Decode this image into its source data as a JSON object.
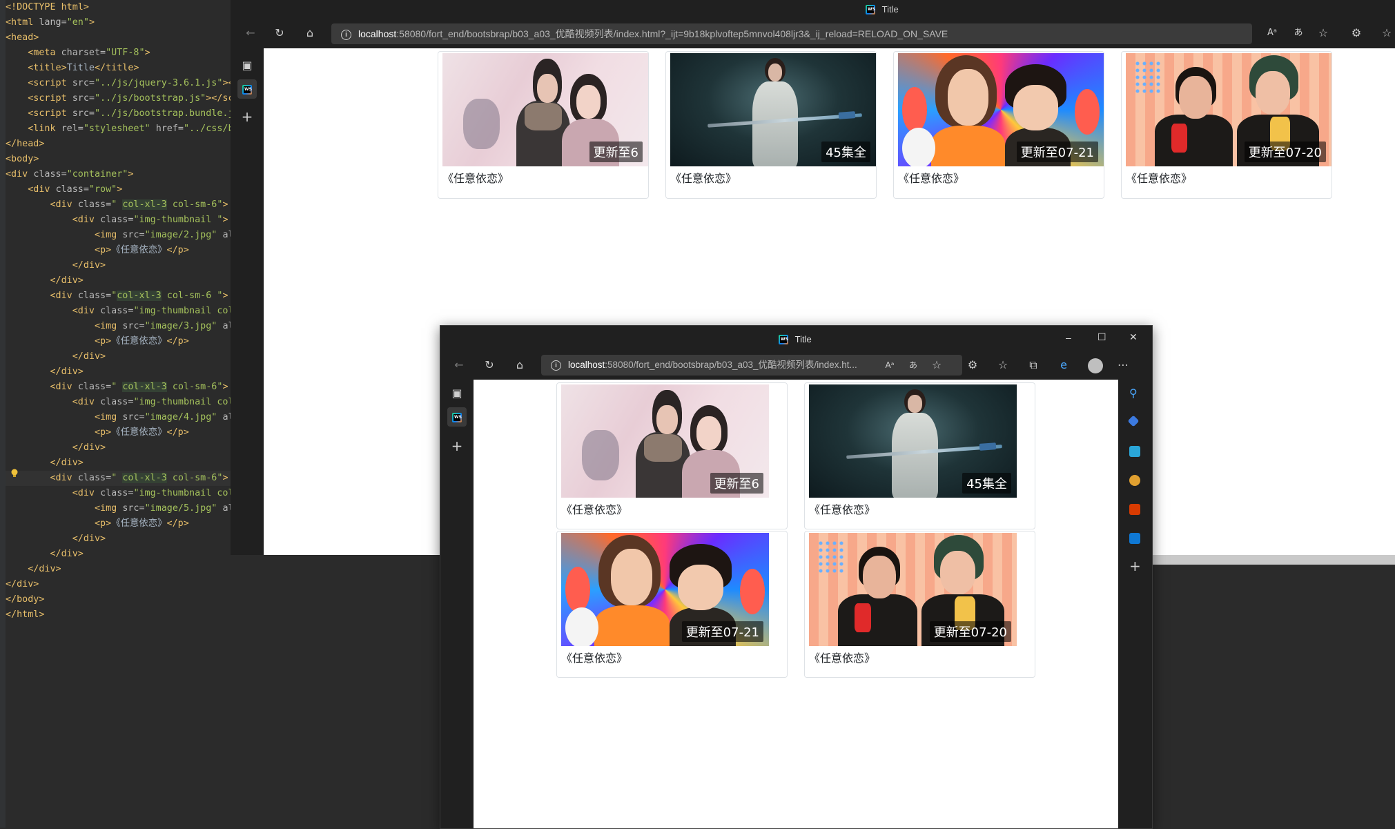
{
  "editor": {
    "lines": [
      [
        [
          "tag",
          "<!DOCTYPE html>"
        ]
      ],
      [
        [
          "tag",
          "<html "
        ],
        [
          "attr",
          "lang="
        ],
        [
          "str",
          "\"en\""
        ],
        [
          "tag",
          ">"
        ]
      ],
      [
        [
          "tag",
          "<head>"
        ]
      ],
      [
        [
          "txt",
          "    "
        ],
        [
          "tag",
          "<meta "
        ],
        [
          "attr",
          "charset="
        ],
        [
          "str",
          "\"UTF-8\""
        ],
        [
          "tag",
          ">"
        ]
      ],
      [
        [
          "txt",
          "    "
        ],
        [
          "tag",
          "<title>"
        ],
        [
          "txt",
          "Title"
        ],
        [
          "tag",
          "</title>"
        ]
      ],
      [
        [
          "txt",
          "    "
        ],
        [
          "tag",
          "<script "
        ],
        [
          "attr",
          "src="
        ],
        [
          "str",
          "\"../js/jquery-3.6.1.js\""
        ],
        [
          "tag",
          "><"
        ]
      ],
      [
        [
          "txt",
          "    "
        ],
        [
          "tag",
          "<script "
        ],
        [
          "attr",
          "src="
        ],
        [
          "str",
          "\"../js/bootstrap.js\""
        ],
        [
          "tag",
          "></sc"
        ]
      ],
      [
        [
          "txt",
          "    "
        ],
        [
          "tag",
          "<script "
        ],
        [
          "attr",
          "src="
        ],
        [
          "str",
          "\"../js/bootstrap.bundle.j"
        ]
      ],
      [
        [
          "txt",
          "    "
        ],
        [
          "tag",
          "<link "
        ],
        [
          "attr",
          "rel="
        ],
        [
          "str",
          "\"stylesheet\" "
        ],
        [
          "attr",
          "href="
        ],
        [
          "str",
          "\"../css/b"
        ]
      ],
      [
        [
          "tag",
          "</head>"
        ]
      ],
      [
        [
          "tag",
          "<body>"
        ]
      ],
      [
        [
          "tag",
          "<div "
        ],
        [
          "attr",
          "class="
        ],
        [
          "str",
          "\"container\""
        ],
        [
          "tag",
          ">"
        ]
      ],
      [
        [
          "txt",
          "    "
        ],
        [
          "tag",
          "<div "
        ],
        [
          "attr",
          "class="
        ],
        [
          "str",
          "\"row\""
        ],
        [
          "tag",
          ">"
        ]
      ],
      [
        [
          "txt",
          "        "
        ],
        [
          "tag",
          "<div "
        ],
        [
          "attr",
          "class="
        ],
        [
          "str",
          "\" "
        ],
        [
          "cls",
          "col-xl-3"
        ],
        [
          "str",
          " col-sm-6\""
        ],
        [
          "tag",
          ">"
        ]
      ],
      [
        [
          "txt",
          "            "
        ],
        [
          "tag",
          "<div "
        ],
        [
          "attr",
          "class="
        ],
        [
          "str",
          "\"img-thumbnail \""
        ],
        [
          "tag",
          ">"
        ]
      ],
      [
        [
          "txt",
          "                "
        ],
        [
          "tag",
          "<img "
        ],
        [
          "attr",
          "src="
        ],
        [
          "str",
          "\"image/2.jpg\" "
        ],
        [
          "attr",
          "al"
        ]
      ],
      [
        [
          "txt",
          "                "
        ],
        [
          "tag",
          "<p>"
        ],
        [
          "txt",
          "《任意依恋》"
        ],
        [
          "tag",
          "</p>"
        ]
      ],
      [
        [
          "txt",
          "            "
        ],
        [
          "tag",
          "</div>"
        ]
      ],
      [
        [
          "txt",
          "        "
        ],
        [
          "tag",
          "</div>"
        ]
      ],
      [
        [
          "txt",
          "        "
        ],
        [
          "tag",
          "<div "
        ],
        [
          "attr",
          "class="
        ],
        [
          "str",
          "\""
        ],
        [
          "cls",
          "col-xl-3"
        ],
        [
          "str",
          " col-sm-6 \""
        ],
        [
          "tag",
          ">"
        ]
      ],
      [
        [
          "txt",
          "            "
        ],
        [
          "tag",
          "<div "
        ],
        [
          "attr",
          "class="
        ],
        [
          "str",
          "\"img-thumbnail col"
        ]
      ],
      [
        [
          "txt",
          "                "
        ],
        [
          "tag",
          "<img "
        ],
        [
          "attr",
          "src="
        ],
        [
          "str",
          "\"image/3.jpg\" "
        ],
        [
          "attr",
          "al"
        ]
      ],
      [
        [
          "txt",
          "                "
        ],
        [
          "tag",
          "<p>"
        ],
        [
          "txt",
          "《任意依恋》"
        ],
        [
          "tag",
          "</p>"
        ]
      ],
      [
        [
          "txt",
          "            "
        ],
        [
          "tag",
          "</div>"
        ]
      ],
      [
        [
          "txt",
          "        "
        ],
        [
          "tag",
          "</div>"
        ]
      ],
      [
        [
          "txt",
          "        "
        ],
        [
          "tag",
          "<div "
        ],
        [
          "attr",
          "class="
        ],
        [
          "str",
          "\" "
        ],
        [
          "cls",
          "col-xl-3"
        ],
        [
          "str",
          " col-sm-6\""
        ],
        [
          "tag",
          ">"
        ]
      ],
      [
        [
          "txt",
          "            "
        ],
        [
          "tag",
          "<div "
        ],
        [
          "attr",
          "class="
        ],
        [
          "str",
          "\"img-thumbnail col"
        ]
      ],
      [
        [
          "txt",
          "                "
        ],
        [
          "tag",
          "<img "
        ],
        [
          "attr",
          "src="
        ],
        [
          "str",
          "\"image/4.jpg\" "
        ],
        [
          "attr",
          "al"
        ]
      ],
      [
        [
          "txt",
          "                "
        ],
        [
          "tag",
          "<p>"
        ],
        [
          "txt",
          "《任意依恋》"
        ],
        [
          "tag",
          "</p>"
        ]
      ],
      [
        [
          "txt",
          "            "
        ],
        [
          "tag",
          "</div>"
        ]
      ],
      [
        [
          "txt",
          "        "
        ],
        [
          "tag",
          "</div>"
        ]
      ],
      [
        [
          "txt",
          "        "
        ],
        [
          "tag",
          "<div "
        ],
        [
          "attr",
          "class="
        ],
        [
          "str",
          "\" "
        ],
        [
          "cls",
          "col-xl-3"
        ],
        [
          "str",
          " col-sm-6\""
        ],
        [
          "tag",
          ">"
        ]
      ],
      [
        [
          "txt",
          "            "
        ],
        [
          "tag",
          "<div "
        ],
        [
          "attr",
          "class="
        ],
        [
          "str",
          "\"img-thumbnail col"
        ]
      ],
      [
        [
          "txt",
          "                "
        ],
        [
          "tag",
          "<img "
        ],
        [
          "attr",
          "src="
        ],
        [
          "str",
          "\"image/5.jpg\" "
        ],
        [
          "attr",
          "al"
        ]
      ],
      [
        [
          "txt",
          "                "
        ],
        [
          "tag",
          "<p>"
        ],
        [
          "txt",
          "《任意依恋》"
        ],
        [
          "tag",
          "</p>"
        ]
      ],
      [
        [
          "txt",
          "            "
        ],
        [
          "tag",
          "</div>"
        ]
      ],
      [
        [
          "txt",
          "        "
        ],
        [
          "tag",
          "</div>"
        ]
      ],
      [
        [
          "txt",
          "    "
        ],
        [
          "tag",
          "</div>"
        ]
      ],
      [
        [
          "tag",
          "</div>"
        ]
      ],
      [
        [
          "tag",
          "</body>"
        ]
      ],
      [
        [
          "tag",
          "</html>"
        ]
      ]
    ],
    "highlight_line": 31,
    "bulb_icon": "lightbulb-icon"
  },
  "browser_back": {
    "title": "Title",
    "url_host": "localhost",
    "url_path": ":58080/fort_end/bootsbrap/b03_a03_优酷视频列表/index.html?_ijt=9b18kplvoftep5mnvol408ljr3&_ij_reload=RELOAD_ON_SAVE"
  },
  "browser_front": {
    "title": "Title",
    "url_host": "localhost",
    "url_path": ":58080/fort_end/bootsbrap/b03_a03_优酷视频列表/index.ht...",
    "window_controls": {
      "minimize": "–",
      "maximize": "☐",
      "close": "✕"
    }
  },
  "videos": [
    {
      "badge": "更新至6",
      "caption": "《任意依恋》"
    },
    {
      "badge": "45集全",
      "caption": "《任意依恋》"
    },
    {
      "badge": "更新至07-21",
      "caption": "《任意依恋》"
    },
    {
      "badge": "更新至07-20",
      "caption": "《任意依恋》"
    }
  ],
  "colors": {
    "editor_bg": "#2b2b2b",
    "browser_chrome": "#202020",
    "thumbnail_border": "#dee2e6"
  }
}
